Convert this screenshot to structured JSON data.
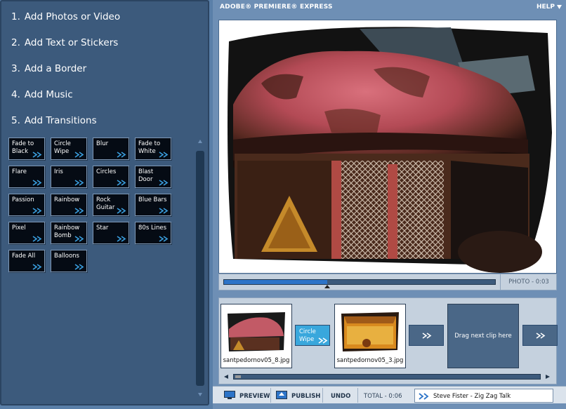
{
  "steps": [
    {
      "num": "1.",
      "label": "Add Photos or Video"
    },
    {
      "num": "2.",
      "label": "Add Text or Stickers"
    },
    {
      "num": "3.",
      "label": "Add a Border"
    },
    {
      "num": "4.",
      "label": "Add Music"
    },
    {
      "num": "5.",
      "label": "Add Transitions"
    }
  ],
  "transitions": [
    "Fade to\nBlack",
    "Circle\nWipe",
    "Blur",
    "Fade to\nWhite",
    "Flare",
    "Iris",
    "Circles",
    "Blast Door",
    "Passion",
    "Rainbow",
    "Rock\nGuitar",
    "Blue Bars",
    "Pixel",
    "Rainbow\nBomb",
    "Star",
    "80s Lines",
    "Fade All",
    "Balloons"
  ],
  "header": {
    "title": "ADOBE® PREMIERE® EXPRESS",
    "help": "HELP"
  },
  "player": {
    "progress": 0.38,
    "clip_info": "PHOTO - 0:03"
  },
  "timeline": {
    "clips": [
      {
        "filename": "santpedornov05_8.jpg"
      },
      {
        "filename": "santpedornov05_3.jpg"
      }
    ],
    "applied_transition": "Circle\nWipe",
    "drop_zone": "Drag next clip here"
  },
  "bottombar": {
    "preview": "PREVIEW",
    "publish": "PUBLISH",
    "undo": "UNDO",
    "total": "TOTAL - 0:06",
    "music": "Steve Fister - Zig Zag Talk"
  },
  "colors": {
    "panel": "#3c5a7c",
    "accent": "#39a7dc",
    "button": "#050b14"
  }
}
